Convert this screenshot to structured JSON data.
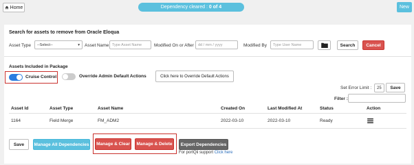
{
  "topbar": {
    "home_label": "Home",
    "dependency_label": "Dependency cleared :",
    "dependency_value": "0 of 4",
    "new_label": "New"
  },
  "search": {
    "title": "Search for assets to remove from Oracle Eloqua",
    "asset_type_label": "Asset Type",
    "asset_type_value": "--Select--",
    "asset_name_label": "Asset Name",
    "asset_name_placeholder": "Type Asset Name",
    "modified_after_label": "Modified On or After",
    "modified_after_placeholder": "dd / mm / yyyy",
    "modified_by_label": "Modified By",
    "modified_by_placeholder": "Type User Name",
    "search_label": "Search",
    "cancel_label": "Cancel"
  },
  "package": {
    "title": "Assets Included in Package",
    "cruise_control_label": "Cruise Control",
    "cruise_control_on": true,
    "override_label": "Override Admin Default Actions",
    "override_on": false,
    "override_button_label": "Click here to Override Default Actions",
    "error_limit_label": "Set Error Limit :",
    "error_limit_value": "25",
    "save_small_label": "Save",
    "filter_label": "Filter :"
  },
  "table": {
    "headers": [
      "Asset Id",
      "Asset Type",
      "Asset Name",
      "Created On",
      "Last Modified At",
      "Status",
      "Action"
    ],
    "rows": [
      [
        "1164",
        "Field Merge",
        "FM_ADM2",
        "2022-03-10",
        "2022-03-10",
        "Ready"
      ]
    ]
  },
  "footer": {
    "save_label": "Save",
    "manage_all_label": "Manage All Dependencies",
    "manage_clear_label": "Manage & Clear",
    "manage_delete_label": "Manage & Delete",
    "export_label": "Export Dependencies",
    "support_text": "For portQii support",
    "support_link": "Click here"
  },
  "colors": {
    "accent_blue": "#5bc0de",
    "danger_red": "#d9534f",
    "toggle_on": "#2a7ce0"
  }
}
